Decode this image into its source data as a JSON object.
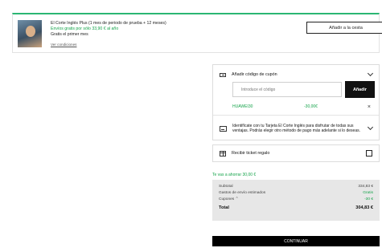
{
  "promo": {
    "title": "El Corte Inglés Plus (1 mes de periodo de prueba + 12 meses)",
    "shipping": "Envíos gratis por sólo 33,90 € al año",
    "free_month": "Gratis el primer mes",
    "conditions_link": "Ver condiciones",
    "add_to_cart": "Añadir a la cesta"
  },
  "coupon": {
    "heading": "Añadir código de cupón",
    "input_placeholder": "Introduce el código",
    "apply_label": "Añadir",
    "applied_code": "HUAWEI30",
    "applied_amount": "-30,00€",
    "remove_symbol": "×"
  },
  "card": {
    "text": "Identifícate con tu Tarjeta El Corte Inglés para disfrutar de todas sus ventajas. Podrás elegir otro método de pago más adelante si lo deseas."
  },
  "gift": {
    "label": "Recibir ticket regalo"
  },
  "savings": "Te vas a ahorrar 30,00 €",
  "summary": {
    "subtotal_label": "Subtotal",
    "subtotal_value": "334,83 €",
    "shipping_label": "Gastos de envío estimados",
    "shipping_value": "Gratis",
    "coupons_label": "Cupones ⌃",
    "coupons_value": "-30 €",
    "total_label": "Total",
    "total_value": "304,83 €"
  },
  "continue_label": "CONTINUAR",
  "colors": {
    "accent_green": "#15a34a",
    "button_black": "#000000",
    "summary_bg": "#e7e7e7"
  }
}
